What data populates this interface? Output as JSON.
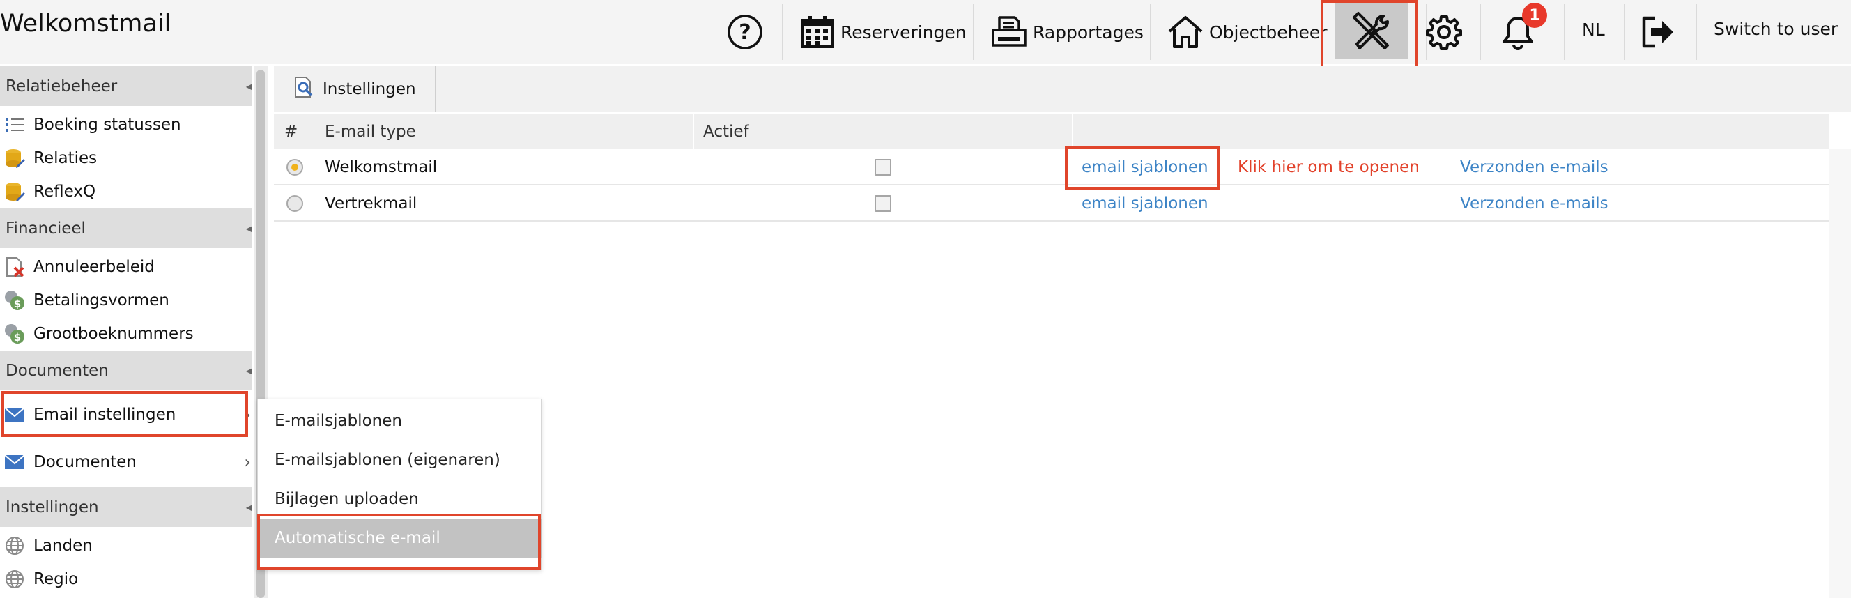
{
  "app": {
    "title": "Welkomstmail"
  },
  "topnav": {
    "help_icon": "help-circle-icon",
    "items": [
      {
        "label": "Reserveringen",
        "icon": "calendar-icon"
      },
      {
        "label": "Rapportages",
        "icon": "printer-icon"
      },
      {
        "label": "Objectbeheer",
        "icon": "house-icon"
      }
    ],
    "tools_icon": "tools-icon",
    "settings_icon": "gear-icon",
    "notifications": {
      "icon": "bell-icon",
      "count": "1"
    },
    "language": "NL",
    "logout_icon": "logout-icon",
    "switch_user": "Switch to user"
  },
  "sidebar": {
    "sections": [
      {
        "title": "Relatiebeheer",
        "items": [
          {
            "label": "Boeking statussen",
            "icon": "list-icon"
          },
          {
            "label": "Relaties",
            "icon": "database-edit-icon"
          },
          {
            "label": "ReflexQ",
            "icon": "database-edit-icon"
          }
        ]
      },
      {
        "title": "Financieel",
        "items": [
          {
            "label": "Annuleerbeleid",
            "icon": "document-cancel-icon"
          },
          {
            "label": "Betalingsvormen",
            "icon": "coins-icon"
          },
          {
            "label": "Grootboeknummers",
            "icon": "coins-icon"
          }
        ]
      },
      {
        "title": "Documenten",
        "items": [
          {
            "label": "Email instellingen",
            "icon": "envelope-icon"
          },
          {
            "label": "Documenten",
            "icon": "envelope-icon"
          }
        ]
      },
      {
        "title": "Instellingen",
        "items": [
          {
            "label": "Landen",
            "icon": "globe-icon"
          },
          {
            "label": "Regio",
            "icon": "globe-icon"
          }
        ]
      }
    ]
  },
  "main": {
    "tab": {
      "label": "Instellingen",
      "icon": "document-search-icon"
    },
    "columns": [
      "#",
      "E-mail type",
      "Actief"
    ],
    "rows": [
      {
        "selected": true,
        "type": "Welkomstmail",
        "active": false,
        "templates": "email sjablonen",
        "note": "Klik hier om te openen",
        "sent": "Verzonden e-mails"
      },
      {
        "selected": false,
        "type": "Vertrekmail",
        "active": false,
        "templates": "email sjablonen",
        "note": "",
        "sent": "Verzonden e-mails"
      }
    ]
  },
  "submenu": {
    "items": [
      {
        "label": "E-mailsjablonen"
      },
      {
        "label": "E-mailsjablonen (eigenaren)"
      },
      {
        "label": "Bijlagen uploaden"
      },
      {
        "label": "Automatische e-mail",
        "active": true
      }
    ]
  },
  "colors": {
    "accent_link": "#3d84c6",
    "highlight": "#e0452b",
    "badge": "#e8392b",
    "radio_selected": "#f0b21b"
  }
}
